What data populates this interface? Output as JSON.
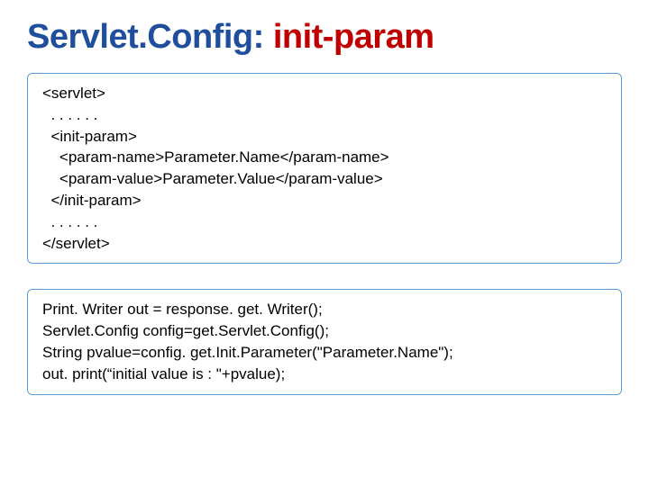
{
  "title": {
    "part1": "Servlet.Config: ",
    "part2": "init-param"
  },
  "box1": {
    "line1": "<servlet>",
    "line2": "  . . . . . .",
    "line3": "  <init-param>",
    "line4": "    <param-name>Parameter.Name</param-name>",
    "line5": "    <param-value>Parameter.Value</param-value>",
    "line6": "  </init-param>",
    "line7": "  . . . . . .",
    "line8": "</servlet>"
  },
  "box2": {
    "line1": "Print. Writer out = response. get. Writer();",
    "line2": "Servlet.Config config=get.Servlet.Config();",
    "line3": "String pvalue=config. get.Init.Parameter(\"Parameter.Name\");",
    "line4": "out. print(“initial value is : \"+pvalue);"
  }
}
